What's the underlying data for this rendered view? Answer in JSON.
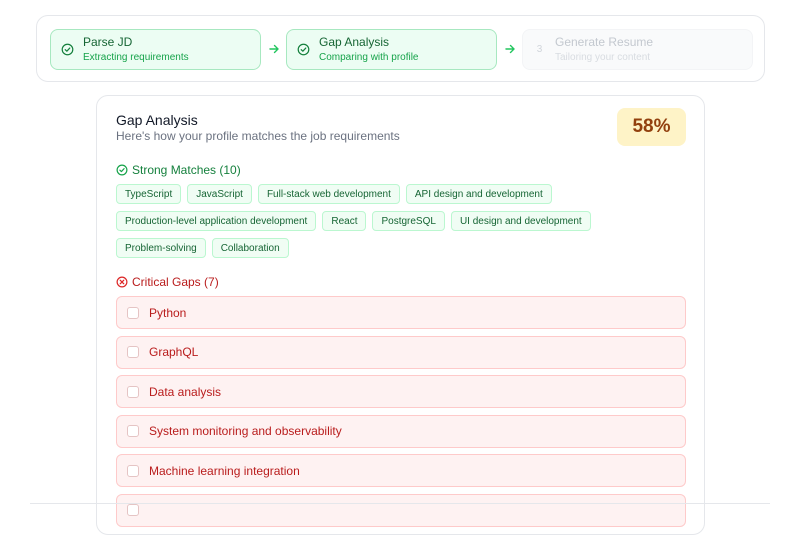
{
  "steps": [
    {
      "title": "Parse JD",
      "subtitle": "Extracting requirements",
      "state": "done",
      "icon": "check-circle-icon"
    },
    {
      "title": "Gap Analysis",
      "subtitle": "Comparing with profile",
      "state": "done",
      "icon": "check-circle-icon"
    },
    {
      "number": "3",
      "title": "Generate Resume",
      "subtitle": "Tailoring your content",
      "state": "pending"
    }
  ],
  "analysis": {
    "title": "Gap Analysis",
    "subtitle": "Here's how your profile matches the job requirements",
    "score": "58%"
  },
  "strong_matches": {
    "heading": "Strong Matches (10)",
    "items": [
      "TypeScript",
      "JavaScript",
      "Full-stack web development",
      "API design and development",
      "Production-level application development",
      "React",
      "PostgreSQL",
      "UI design and development",
      "Problem-solving",
      "Collaboration"
    ]
  },
  "critical_gaps": {
    "heading": "Critical Gaps (7)",
    "items": [
      "Python",
      "GraphQL",
      "Data analysis",
      "System monitoring and observability",
      "Machine learning integration",
      ""
    ]
  },
  "colors": {
    "success": "#16a34a",
    "danger": "#dc2626",
    "score_bg": "#fef3c7",
    "score_text": "#92400e"
  }
}
